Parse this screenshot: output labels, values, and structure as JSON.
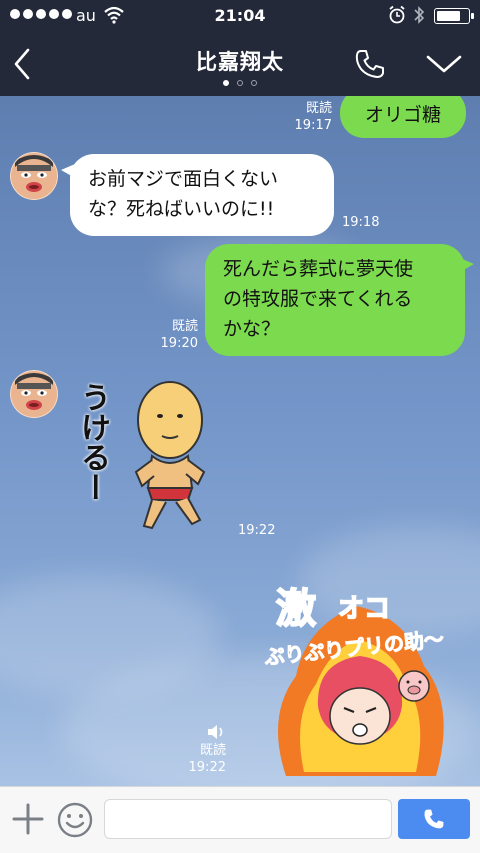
{
  "status_bar": {
    "carrier": "au",
    "time": "21:04",
    "battery_level": 0.82,
    "signal_bars": 5
  },
  "header": {
    "contact_name": "比嘉翔太",
    "pager_count": 3,
    "pager_active_index": 0
  },
  "messages": [
    {
      "direction": "outgoing",
      "type": "text",
      "text": "オリゴ糖",
      "read_label": "既読",
      "time": "19:17"
    },
    {
      "direction": "incoming",
      "type": "text",
      "lines": [
        "お前マジで面白くない",
        "な？死ねばいいのに!!"
      ],
      "time": "19:18"
    },
    {
      "direction": "outgoing",
      "type": "text",
      "lines": [
        "死んだら葬式に夢天使",
        "の特攻服で来てくれる",
        "かな？"
      ],
      "read_label": "既読",
      "time": "19:20"
    },
    {
      "direction": "incoming",
      "type": "sticker",
      "sticker_text": "うけるー",
      "time": "19:22"
    },
    {
      "direction": "outgoing",
      "type": "sticker",
      "sticker_lines": [
        "激",
        "オコ",
        "ぷりぷりプリの助〜"
      ],
      "sound_icon": "speaker-icon",
      "read_label": "既読",
      "time": "19:22"
    }
  ],
  "input_bar": {
    "placeholder": ""
  },
  "colors": {
    "header_bg": "#232938",
    "outgoing_bubble": "#7cda4e",
    "incoming_bubble": "#ffffff",
    "chat_bg": "#6f8fbf",
    "call_button": "#4c8bef"
  }
}
